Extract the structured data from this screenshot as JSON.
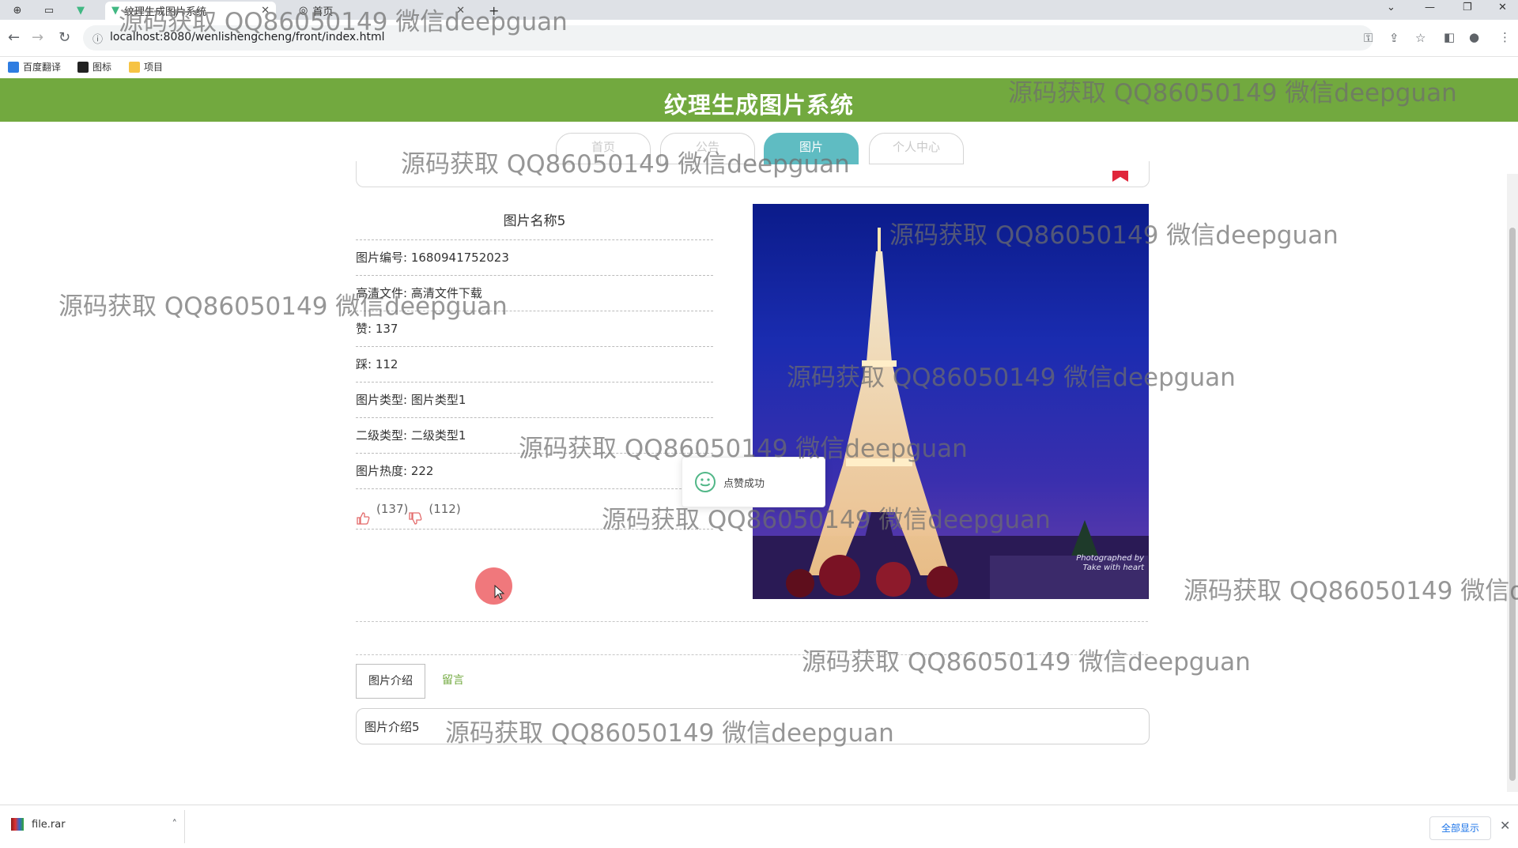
{
  "browser": {
    "tab_title": "纹理生成图片系统",
    "tab2_title": "首页",
    "url": "localhost:8080/wenlishengcheng/front/index.html",
    "bookmarks": [
      "百度翻译",
      "图标",
      "项目"
    ]
  },
  "site": {
    "title": "纹理生成图片系统",
    "nav": [
      "首页",
      "公告",
      "图片",
      "个人中心"
    ],
    "active_nav": "图片"
  },
  "detail": {
    "name": "图片名称5",
    "rows": [
      "图片编号: 1680941752023",
      "高清文件: 高清文件下载",
      "赞: 137",
      "踩: 112",
      "图片类型: 图片类型1",
      "二级类型: 二级类型1",
      "图片热度: 222"
    ],
    "like_count": "(137)",
    "dislike_count": "(112)",
    "photo_credit_1": "Photographed by",
    "photo_credit_2": "Take with heart"
  },
  "toast": {
    "message": "点赞成功"
  },
  "tabs": {
    "intro": "图片介绍",
    "comment": "留言",
    "intro_text": "图片介绍5"
  },
  "download": {
    "file": "file.rar",
    "show_all": "全部显示"
  },
  "watermark": "源码获取 QQ86050149 微信deepguan",
  "colors": {
    "header": "#72a93f",
    "active_nav": "#5fbcc2",
    "flag": "#e0263b"
  }
}
